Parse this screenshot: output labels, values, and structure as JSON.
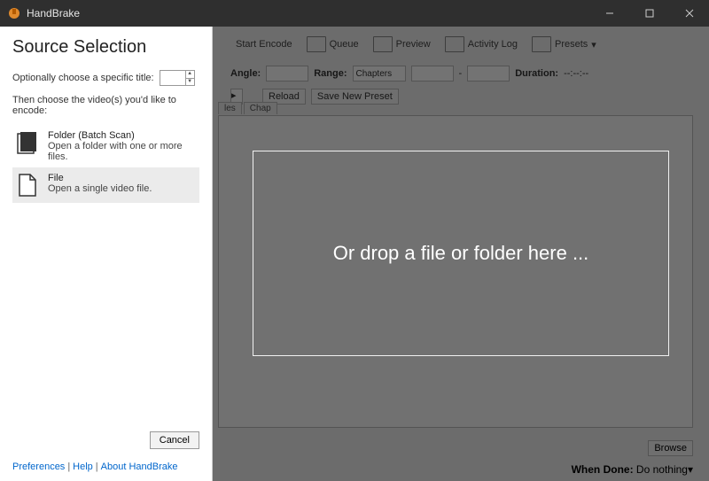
{
  "titlebar": {
    "app_name": "HandBrake"
  },
  "toolbar": {
    "start_encode": "Start Encode",
    "queue": "Queue",
    "preview": "Preview",
    "activity_log": "Activity Log",
    "presets": "Presets"
  },
  "form": {
    "angle_label": "Angle:",
    "range_label": "Range:",
    "range_value": "Chapters",
    "dash": "-",
    "duration_label": "Duration:",
    "duration_value": "--:--:--",
    "reload": "Reload",
    "save_preset": "Save New Preset"
  },
  "tabs": {
    "t1": "les",
    "t2": "Chap"
  },
  "browse": "Browse",
  "when_done": {
    "label": "When Done:",
    "value": "Do nothing"
  },
  "sidebar": {
    "title": "Source Selection",
    "optional_label": "Optionally choose a specific title:",
    "spin_value": "",
    "then_label": "Then choose the video(s) you'd like to encode:",
    "folder_title": "Folder (Batch Scan)",
    "folder_sub": "Open a folder with one or more files.",
    "file_title": "File",
    "file_sub": "Open a single video file.",
    "cancel": "Cancel",
    "pref": "Preferences",
    "help": "Help",
    "about": "About HandBrake"
  },
  "dropzone": {
    "text": "Or drop a file or folder here ..."
  }
}
